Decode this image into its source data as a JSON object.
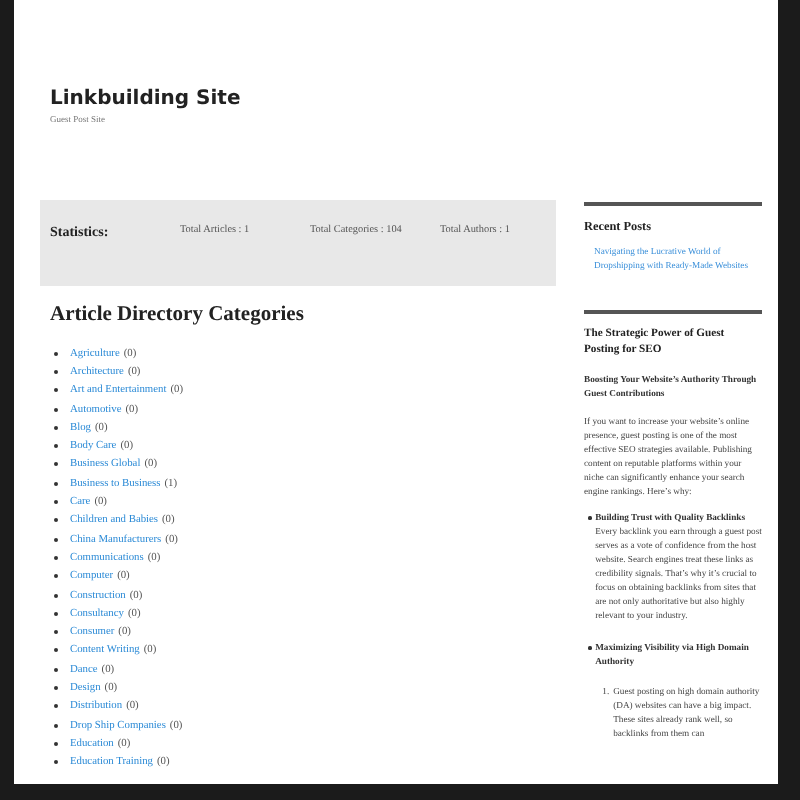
{
  "site": {
    "title": "Linkbuilding Site",
    "tagline": "Guest Post Site"
  },
  "statistics": {
    "label": "Statistics:",
    "items": [
      "Total Articles : 1",
      "Total Categories : 104",
      "Total Authors : 1"
    ]
  },
  "directory": {
    "heading": "Article Directory Categories",
    "categories": [
      {
        "name": "Agriculture",
        "count": "(0)"
      },
      {
        "name": "Architecture",
        "count": "(0)"
      },
      {
        "name": "Art and Entertainment",
        "count": "(0)"
      },
      {
        "name": "Automotive",
        "count": "(0)"
      },
      {
        "name": "Blog",
        "count": "(0)"
      },
      {
        "name": "Body Care",
        "count": "(0)"
      },
      {
        "name": "Business Global",
        "count": "(0)"
      },
      {
        "name": "Business to Business",
        "count": "(1)"
      },
      {
        "name": "Care",
        "count": "(0)"
      },
      {
        "name": "Children and Babies",
        "count": "(0)"
      },
      {
        "name": "China Manufacturers",
        "count": "(0)"
      },
      {
        "name": "Communications",
        "count": "(0)"
      },
      {
        "name": "Computer",
        "count": "(0)"
      },
      {
        "name": "Construction",
        "count": "(0)"
      },
      {
        "name": "Consultancy",
        "count": "(0)"
      },
      {
        "name": "Consumer",
        "count": "(0)"
      },
      {
        "name": "Content Writing",
        "count": "(0)"
      },
      {
        "name": "Dance",
        "count": "(0)"
      },
      {
        "name": "Design",
        "count": "(0)"
      },
      {
        "name": "Distribution",
        "count": "(0)"
      },
      {
        "name": "Drop Ship Companies",
        "count": "(0)"
      },
      {
        "name": "Education",
        "count": "(0)"
      },
      {
        "name": "Education Training",
        "count": "(0)"
      }
    ]
  },
  "sidebar": {
    "recent_posts": {
      "heading": "Recent Posts",
      "posts": [
        "Navigating the Lucrative World of Dropshipping with Ready-Made Websites"
      ]
    },
    "article": {
      "title": "The Strategic Power of Guest Posting for SEO",
      "subtitle": "Boosting Your Website’s Authority Through Guest Contributions",
      "intro": "If you want to increase your website’s online presence, guest posting is one of the most effective SEO strategies available. Publishing content on reputable platforms within your niche can significantly enhance your search engine rankings. Here’s why:",
      "bullets": [
        {
          "heading": "Building Trust with Quality Backlinks",
          "text": "Every backlink you earn through a guest post serves as a vote of confidence from the host website. Search engines treat these links as credibility signals. That’s why it’s crucial to focus on obtaining backlinks from sites that are not only authoritative but also highly relevant to your industry."
        },
        {
          "heading": "Maximizing Visibility via High Domain Authority",
          "numbered": [
            {
              "number": "1.",
              "text": "Guest posting on high domain authority (DA) websites can have a big impact. These sites already rank well, so backlinks from them can"
            }
          ]
        }
      ]
    }
  }
}
